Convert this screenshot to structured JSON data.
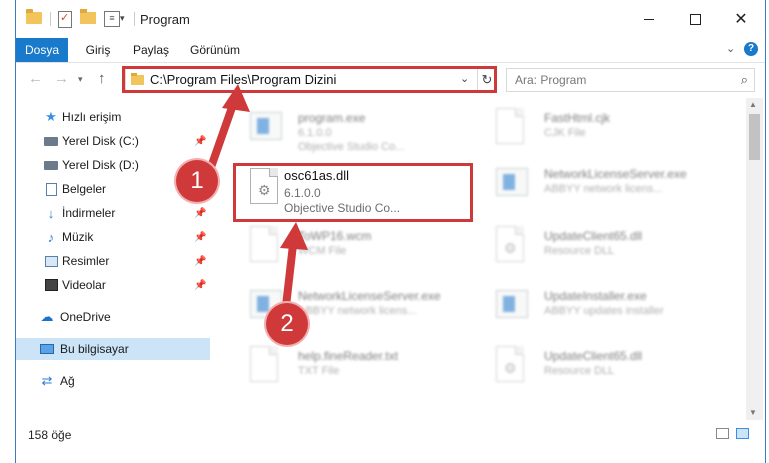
{
  "window": {
    "title": "Program",
    "buttons": {
      "minimize_icon": "minimize-icon",
      "maximize_icon": "maximize-icon",
      "close_glyph": "✕"
    }
  },
  "ribbon": {
    "tabs": [
      {
        "label": "Dosya",
        "active": true
      },
      {
        "label": "Giriş"
      },
      {
        "label": "Paylaş"
      },
      {
        "label": "Görünüm"
      }
    ],
    "help_glyph": "?"
  },
  "address": {
    "path": "C:\\Program Files\\Program Dizini",
    "refresh_glyph": "↻"
  },
  "search": {
    "placeholder": "Ara: Program"
  },
  "nav_pane": {
    "items": [
      {
        "label": "Hızlı erişim",
        "icon": "star-icon"
      },
      {
        "label": "Yerel Disk (C:)",
        "icon": "disk-icon",
        "pinned": true
      },
      {
        "label": "Yerel Disk (D:)",
        "icon": "disk-icon"
      },
      {
        "label": "Belgeler",
        "icon": "documents-icon"
      },
      {
        "label": "İndirmeler",
        "icon": "downloads-icon",
        "pinned": true
      },
      {
        "label": "Müzik",
        "icon": "music-icon",
        "pinned": true
      },
      {
        "label": "Resimler",
        "icon": "pictures-icon",
        "pinned": true
      },
      {
        "label": "Videolar",
        "icon": "videos-icon",
        "pinned": true
      },
      {
        "label": "OneDrive",
        "icon": "onedrive-icon"
      },
      {
        "label": "Bu bilgisayar",
        "icon": "computer-icon",
        "selected": true
      },
      {
        "label": "Ağ",
        "icon": "network-icon"
      }
    ]
  },
  "files": {
    "highlighted": {
      "name": "osc61as.dll",
      "version": "6.1.0.0",
      "company": "Objective Studio Co..."
    },
    "background": [
      {
        "name": "program.exe",
        "line2": "6.1.0.0",
        "line3": "Objective Studio Co..."
      },
      {
        "name": "FastHtml.cjk",
        "line2": "CJK File",
        "line3": ""
      },
      {
        "name": "NetworkLicenseServer.exe",
        "line2": "ABBYY network licens...",
        "line3": ""
      },
      {
        "name": "ToWP16.wcm",
        "line2": "WCM File",
        "line3": ""
      },
      {
        "name": "UpdateClient65.dll",
        "line2": "Resource DLL",
        "line3": ""
      },
      {
        "name": "NetworkLicenseServer.exe",
        "line2": "ABBYY network licens...",
        "line3": ""
      },
      {
        "name": "UpdateInstaller.exe",
        "line2": "ABBYY updates installer",
        "line3": ""
      },
      {
        "name": "help.fineReader.txt",
        "line2": "TXT File",
        "line3": ""
      },
      {
        "name": "UpdateClient65.dll",
        "line2": "Resource DLL",
        "line3": ""
      }
    ]
  },
  "status": {
    "item_count": "158 öğe"
  },
  "annotations": {
    "marker_1": "1",
    "marker_2": "2",
    "color": "#d0393a"
  },
  "colors": {
    "accent": "#1979ca",
    "highlight": "#d0393a",
    "selection": "#cce4f7"
  }
}
